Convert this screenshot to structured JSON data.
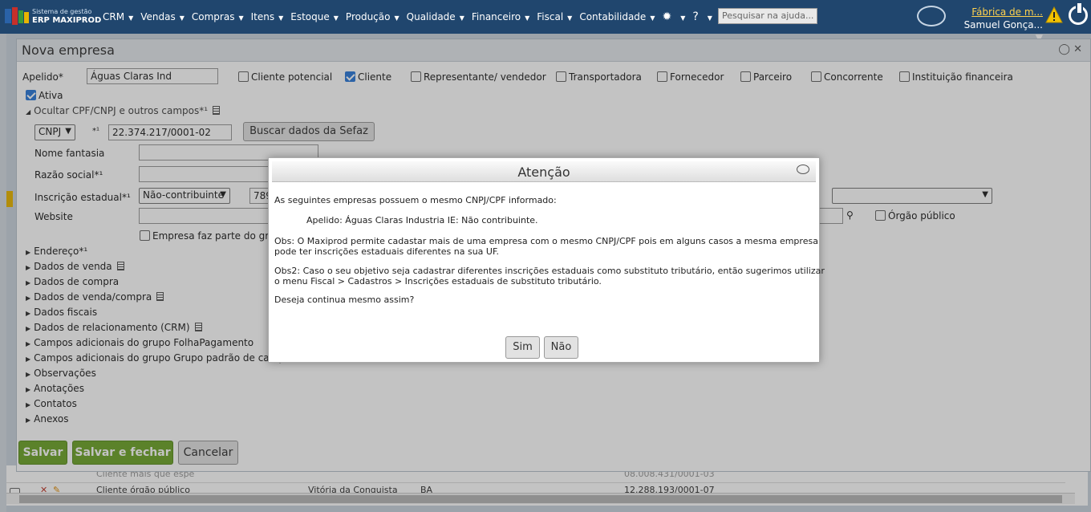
{
  "topbar": {
    "brand_small": "Sistema de gestão",
    "brand_big": "ERP MAXIPROD",
    "menu": [
      "CRM",
      "Vendas",
      "Compras",
      "Itens",
      "Estoque",
      "Produção",
      "Qualidade",
      "Financeiro",
      "Fiscal",
      "Contabilidade"
    ],
    "search_placeholder": "Pesquisar na ajuda...",
    "company": "Fábrica de m...",
    "user": "Samuel Gonça..."
  },
  "window": {
    "title": "Nova empresa",
    "apelido_label": "Apelido*",
    "apelido_value": "Águas Claras Ind",
    "types": [
      {
        "label": "Cliente potencial",
        "checked": false
      },
      {
        "label": "Cliente",
        "checked": true
      },
      {
        "label": "Representante/ vendedor",
        "checked": false
      },
      {
        "label": "Transportadora",
        "checked": false
      },
      {
        "label": "Fornecedor",
        "checked": false
      },
      {
        "label": "Parceiro",
        "checked": false
      },
      {
        "label": "Concorrente",
        "checked": false
      },
      {
        "label": "Instituição financeira",
        "checked": false
      }
    ],
    "ativa_label": "Ativa",
    "ocultar_label": "Ocultar CPF/CNPJ e outros campos*¹",
    "doc_type": "CNPJ",
    "doc_star": "*¹",
    "doc_value": "22.374.217/0001-02",
    "buscar_sefaz": "Buscar dados da Sefaz",
    "nome_fantasia_label": "Nome fantasia",
    "razao_social_label": "Razão social*¹",
    "inscricao_label": "Inscrição estadual*¹",
    "inscricao_select": "Não-contribuinte",
    "inscricao_value": "789",
    "website_label": "Website",
    "grupo_label": "Empresa faz parte do grupo",
    "orgao_publico_label": "Órgão público",
    "sections": [
      {
        "label": "Endereço*¹",
        "doc": false
      },
      {
        "label": "Dados de venda",
        "doc": true
      },
      {
        "label": "Dados de compra",
        "doc": false
      },
      {
        "label": "Dados de venda/compra",
        "doc": true
      },
      {
        "label": "Dados fiscais",
        "doc": false
      },
      {
        "label": "Dados de relacionamento (CRM)",
        "doc": true
      },
      {
        "label": "Campos adicionais do grupo FolhaPagamento",
        "doc": false
      },
      {
        "label": "Campos adicionais do grupo Grupo padrão de campos",
        "doc": false
      },
      {
        "label": "Observações",
        "doc": false
      },
      {
        "label": "Anotações",
        "doc": false
      },
      {
        "label": "Contatos",
        "doc": false
      },
      {
        "label": "Anexos",
        "doc": false
      }
    ],
    "save": "Salvar",
    "save_close": "Salvar e fechar",
    "cancel": "Cancelar"
  },
  "background_grid": {
    "row1": {
      "name": "Cliente mais que espe",
      "doc": "08.008.431/0001-03"
    },
    "row2": {
      "name": "Cliente órgão público",
      "city": "Vitória da Conquista",
      "uf": "BA",
      "doc": "12.288.193/0001-07"
    }
  },
  "modal": {
    "title": "Atenção",
    "line1": "As seguintes empresas possuem o mesmo CNPJ/CPF informado:",
    "line2": "Apelido: Águas Claras Industria IE: Não contribuinte.",
    "obs1_a": "Obs: O Maxiprod permite cadastar mais de uma empresa com o mesmo CNPJ/CPF pois em alguns casos a mesma empresa",
    "obs1_b": "pode ter inscrições estaduais diferentes na sua UF.",
    "obs2_a": "Obs2: Caso o seu objetivo seja cadastrar diferentes inscrições estaduais como substituto tributário, então sugerimos utilizar",
    "obs2_b": "o menu Fiscal > Cadastros > Inscrições estaduais de substituto tributário.",
    "question": "Deseja continua mesmo assim?",
    "yes": "Sim",
    "no": "Não"
  }
}
